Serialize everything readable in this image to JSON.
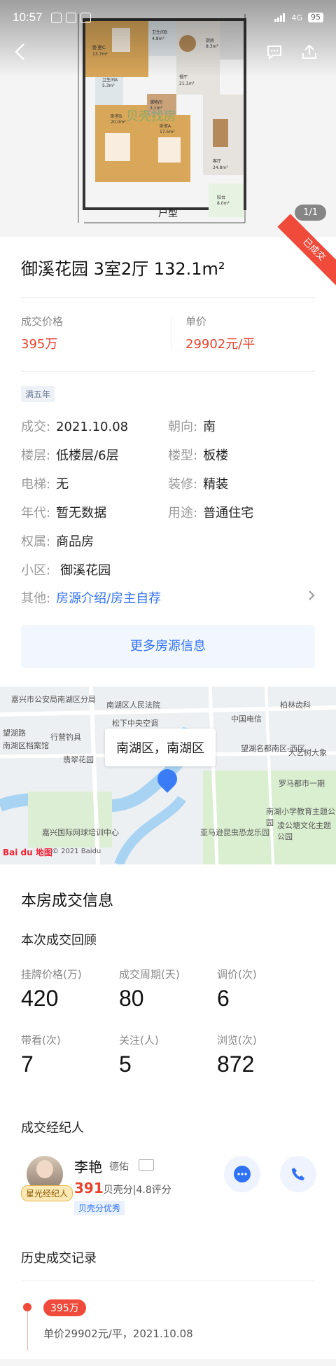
{
  "status_bar": {
    "time": "10:57",
    "right_text": "4G",
    "battery": "95"
  },
  "hero": {
    "caption": "户型",
    "pager": "1/1",
    "watermark": "贝壳找房",
    "rooms": [
      {
        "name": "卫生间C",
        "area": ""
      },
      {
        "name": "卧室C",
        "area": "13.7m²"
      },
      {
        "name": "卫生间A",
        "area": "5.3m²"
      },
      {
        "name": "卧室B",
        "area": "20.0m²"
      },
      {
        "name": "储物间",
        "area": "3.1m²"
      },
      {
        "name": "卧室A",
        "area": "17.5m²"
      },
      {
        "name": "餐厅",
        "area": "21.1m²"
      },
      {
        "name": "厨房",
        "area": "8.3m²"
      },
      {
        "name": "客厅",
        "area": "24.8m²"
      },
      {
        "name": "阳台",
        "area": "8.0m²"
      },
      {
        "name": "卫生间B",
        "area": "4.8m²"
      }
    ]
  },
  "listing": {
    "sold_ribbon": "已成交",
    "title": "御溪花园 3室2厅 132.1m²",
    "deal_price_label": "成交价格",
    "deal_price": "395万",
    "unit_price_label": "单价",
    "unit_price": "29902元/平",
    "tag": "满五年",
    "info": {
      "deal_label": "成交:",
      "deal_value": "2021.10.08",
      "orient_label": "朝向:",
      "orient_value": "南",
      "floor_label": "楼层:",
      "floor_value": "低楼层/6层",
      "building_label": "楼型:",
      "building_value": "板楼",
      "elevator_label": "电梯:",
      "elevator_value": "无",
      "decor_label": "装修:",
      "decor_value": "精装",
      "year_label": "年代:",
      "year_value": "暂无数据",
      "usage_label": "用途:",
      "usage_value": "普通住宅",
      "ownership_label": "权属:",
      "ownership_value": "商品房",
      "community_label": "小区:",
      "community_value": "御溪花园",
      "other_label": "其他:",
      "other_value": "房源介绍/房主自荐"
    },
    "more_button": "更多房源信息"
  },
  "map": {
    "bubble": "南湖区，南湖区",
    "pois": [
      "嘉兴市公安局南湖区分局",
      "南湖区人民法院",
      "中国电信",
      "柏林齿科",
      "行营钓具",
      "松下中央空调",
      "南湖区档案馆",
      "望湖路",
      "翡翠花园",
      "大艺树大象",
      "望湖名都南区-西区",
      "罗马都市一期",
      "嘉兴国际网球培训中心",
      "亚马逊昆虫恐龙乐园",
      "凌公塘文化主题公园",
      "南湖小学教育主题公园"
    ],
    "logo": "Bai du 地图",
    "copyright": "© 2021 Baidu"
  },
  "deal_info": {
    "section_title": "本房成交信息",
    "review_title": "本次成交回顾",
    "stats": [
      {
        "label": "挂牌价格(万)",
        "value": "420"
      },
      {
        "label": "成交周期(天)",
        "value": "80"
      },
      {
        "label": "调价(次)",
        "value": "6"
      },
      {
        "label": "带看(次)",
        "value": "7"
      },
      {
        "label": "关注(人)",
        "value": "5"
      },
      {
        "label": "浏览(次)",
        "value": "872"
      }
    ]
  },
  "agent": {
    "section_title": "成交经纪人",
    "name": "李艳",
    "brand": "德佑",
    "badge": "星光经纪人",
    "score_number": "391",
    "score_text": "贝壳分|4.8评分",
    "score_tag": "贝壳分优秀"
  },
  "history": {
    "section_title": "历史成交记录",
    "records": [
      {
        "price": "395万",
        "detail": "单价29902元/平，2021.10.08"
      }
    ]
  }
}
